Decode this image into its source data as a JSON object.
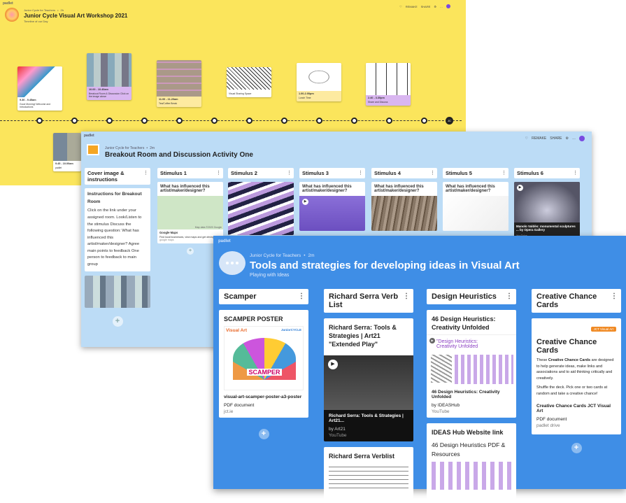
{
  "w1": {
    "brand": "padlet",
    "author": "Junior Cycle for Teachers",
    "time": "2h",
    "title": "Junior Cycle Visual Art Workshop 2021",
    "subtitle": "Timeline of our Day",
    "header_actions": [
      "REMAKE",
      "SHARE"
    ],
    "cards": [
      {
        "time": "9.30 - 9.45am",
        "desc": "Good Morning! Welcome and Introductions"
      },
      {
        "time": "10.00 - 10.40am",
        "desc": "Breakout Room & Discussion Click on the image above"
      },
      {
        "time": "11.00 - 11.20am",
        "desc": "Tea/Coffee Break"
      },
      {
        "time": "",
        "desc": "Visual Sharing Space"
      },
      {
        "time": "1.00-2.00pm",
        "desc": "Lunch Time"
      },
      {
        "time": "2.40 - 3.30pm",
        "desc": "Share and Discuss"
      }
    ],
    "stub_card": {
      "time": "9.45 - 10.00am",
      "desc": "padlet"
    },
    "avatar_initials": "JC"
  },
  "w2": {
    "brand": "padlet",
    "author": "Junior Cycle for Teachers",
    "time": "2m",
    "title": "Breakout Room and Discussion Activity One",
    "header_actions": [
      "REMAKE",
      "SHARE"
    ],
    "columns": [
      {
        "head": "Cover image & instructions"
      },
      {
        "head": "Stimulus 1"
      },
      {
        "head": "Stimulus 2"
      },
      {
        "head": "Stimulus 3"
      },
      {
        "head": "Stimulus 4"
      },
      {
        "head": "Stimulus 5"
      },
      {
        "head": "Stimulus 6"
      }
    ],
    "instructions_title": "Instructions for Breakout Room",
    "instructions_body": "Click on the link under your assigned room. Look/Listen to the stimulus Discuss the following question: What has influenced this artist/maker/designer? Agree main points to feedback One person to feedback to main group",
    "question": "What has influenced this artist/maker/designer?",
    "maps_title": "Google Maps",
    "maps_desc": "Find local businesses, view maps and get driving directions in Google Maps.",
    "maps_src": "google maps",
    "map_credit": "Map data ©2020 Google",
    "stim6_title": "Manolo Valdés: monumental sculptures ... by Opera Gallery",
    "stim6_src": "YouTube"
  },
  "w3": {
    "brand": "padlet",
    "author": "Junior Cycle for Teachers",
    "time": "2m",
    "title": "Tools and strategies for developing ideas in Visual Art",
    "subtitle": "Playing with Ideas",
    "columns": [
      {
        "head": "Scamper"
      },
      {
        "head": "Richard Serra Verb List"
      },
      {
        "head": "Design Heuristics"
      },
      {
        "head": "Creative Chance Cards"
      }
    ],
    "scamper": {
      "title": "SCAMPER POSTER",
      "poster_left": "Visual Art",
      "poster_word": "SCAMPER",
      "poster_right": "JuniorCYCLE",
      "file": "visual-art-scamper-poster-a3-poster",
      "type": "PDF document",
      "src": "jct.ie"
    },
    "serra": {
      "title": "Richard Serra: Tools & Strategies | Art21 \"Extended Play\"",
      "video_title": "Richard Serra: Tools & Strategies | Art21...",
      "by": "by Art21",
      "src": "YouTube",
      "card2_title": "Richard Serra Verblist"
    },
    "design": {
      "title": "46 Design Heuristics: Creativity Unfolded",
      "thumb_text": "\"Design Heuristics: Creativity Unfolded",
      "video_title": "46 Design Heuristics: Creativity Unfolded",
      "by": "by IDEASHub",
      "src": "YouTube",
      "card2_title": "IDEAS Hub Website link",
      "card2_sub": "46 Design Heuristics PDF & Resources"
    },
    "chance": {
      "banner": "JCT Visual Art",
      "heading": "Creative Chance Cards",
      "body1_pre": "These ",
      "body1_bold": "Creative Chance Cards",
      "body1_post": " are designed to help generate ideas, make links and associations and to aid thinking critically and creatively.",
      "body2": "Shuffle the deck. Pick one or two cards at random and take a creative chance!",
      "file": "Creative Chance Cards JCT Visual Art",
      "type": "PDF document",
      "src": "padlet drive"
    },
    "add_symbol": "+"
  },
  "colors": {
    "yellow": "#fbe55c",
    "light_blue": "#bcdcf6",
    "blue": "#3f8ee6",
    "purple_card": "#d9b6f0",
    "cream_card": "#fdeaa0"
  }
}
